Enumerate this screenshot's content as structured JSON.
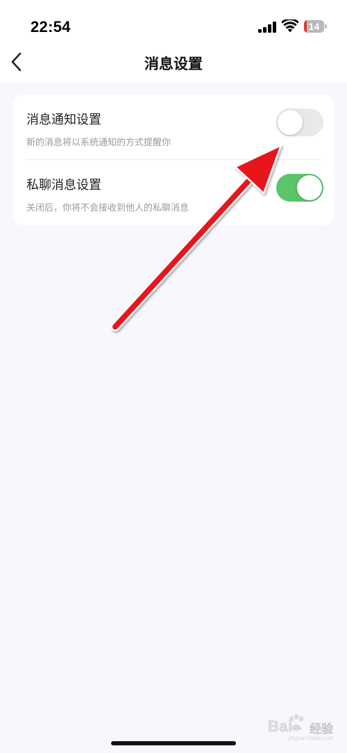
{
  "status_bar": {
    "time": "22:54",
    "battery_level": "14",
    "battery_fraction": 0.14,
    "battery_low_color": "#e23a32",
    "icons": [
      "signal-icon",
      "wifi-icon",
      "battery-icon"
    ]
  },
  "header": {
    "title": "消息设置",
    "back_icon": "chevron-left-icon"
  },
  "settings": [
    {
      "title": "消息通知设置",
      "description": "新的消息将以系统通知的方式提醒你",
      "enabled": false
    },
    {
      "title": "私聊消息设置",
      "description": "关闭后，你将不会接收到他人的私聊消息",
      "enabled": true
    }
  ],
  "colors": {
    "toggle_on": "#5ac56a",
    "toggle_off": "#e9e9ec",
    "annotation_arrow": "#e8141c",
    "page_background": "#f8f7fd"
  },
  "watermark": {
    "brand": "Bai",
    "brand_cn": "经验",
    "url": "jingyan.baidu.com"
  }
}
